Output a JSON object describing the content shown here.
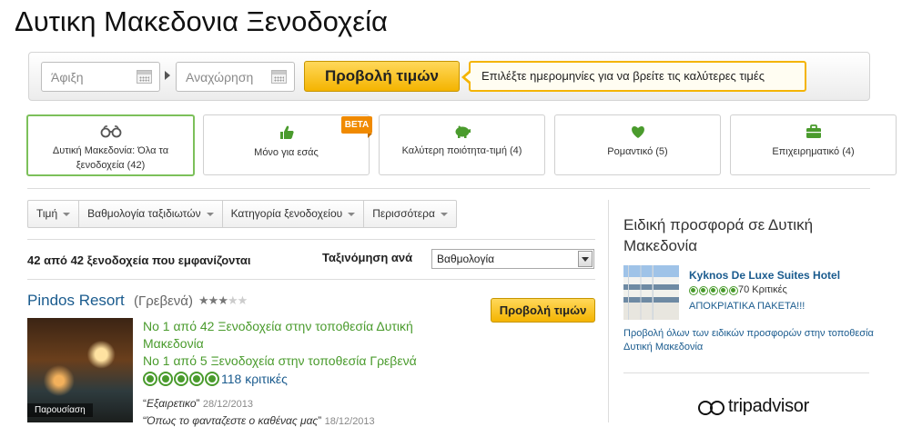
{
  "page": {
    "title": "Δυτικη Μακεδονια Ξενοδοχεία"
  },
  "search": {
    "checkin_placeholder": "Άφιξη",
    "checkout_placeholder": "Αναχώρηση",
    "button_label": "Προβολή τιμών",
    "hint": "Επιλέξτε ημερομηνίες για να βρείτε τις καλύτερες τιμές"
  },
  "categories": [
    {
      "label": "Δυτική Μακεδονία: Όλα τα ξενοδοχεία (42)",
      "icon": "binoculars-icon",
      "active": true
    },
    {
      "label": "Μόνο για εσάς",
      "icon": "thumbs-up-icon",
      "badge": "BETA"
    },
    {
      "label": "Καλύτερη ποιότητα-τιμή (4)",
      "icon": "piggy-bank-icon"
    },
    {
      "label": "Ρομαντικό (5)",
      "icon": "heart-icon"
    },
    {
      "label": "Επιχειρηματικό (4)",
      "icon": "briefcase-icon"
    }
  ],
  "filters": [
    "Τιμή",
    "Βαθμολογία ταξιδιωτών",
    "Κατηγορία ξενοδοχείου",
    "Περισσότερα"
  ],
  "results": {
    "count_text": "42 από 42 ξενοδοχεία που εμφανίζονται",
    "sort_label": "Ταξινόμηση ανά",
    "sort_value": "Βαθμολογία"
  },
  "hotel": {
    "name": "Pindos Resort",
    "location": "(Γρεβενά)",
    "stars": 3,
    "stars_max": 5,
    "button_label": "Προβολή τιμών",
    "photo_label": "Παρουσίαση",
    "rank_1_line_1": "Νο 1 από 42 Ξενοδοχεία στην τοποθεσία Δυτική",
    "rank_1_line_2": "Μακεδονία",
    "rank_2": "Νο 1 από 5 Ξενοδοχεία στην τοποθεσία Γρεβενά",
    "rating_bubbles": 5,
    "review_count": "118 κριτικές",
    "review_1": {
      "text": "Εξαιρετικο",
      "date": "28/12/2013"
    },
    "review_2": {
      "text": "Όπως το φανταζεστε ο καθένας μας",
      "date": "18/12/2013"
    }
  },
  "sidebar": {
    "title": "Ειδική προσφορά σε Δυτική Μακεδονία",
    "hotel_name": "Kyknos De Luxe Suites Hotel",
    "rating_bubbles": 5,
    "reviews": "70 Κριτικές",
    "offer": "ΑΠΟΚΡΙΑΤΙΚΑ ΠΑΚΕΤΑ!!!",
    "all_offers": "Προβολή όλων των ειδικών προσφορών στην τοποθεσία Δυτική Μακεδονία",
    "logo_text": "tripadvisor"
  },
  "colors": {
    "accent_yellow": "#f4b400",
    "link_blue": "#1a5b8e",
    "rating_green": "#4a9b2d",
    "active_tab_border": "#7cc05a",
    "beta_orange": "#f08a00"
  }
}
